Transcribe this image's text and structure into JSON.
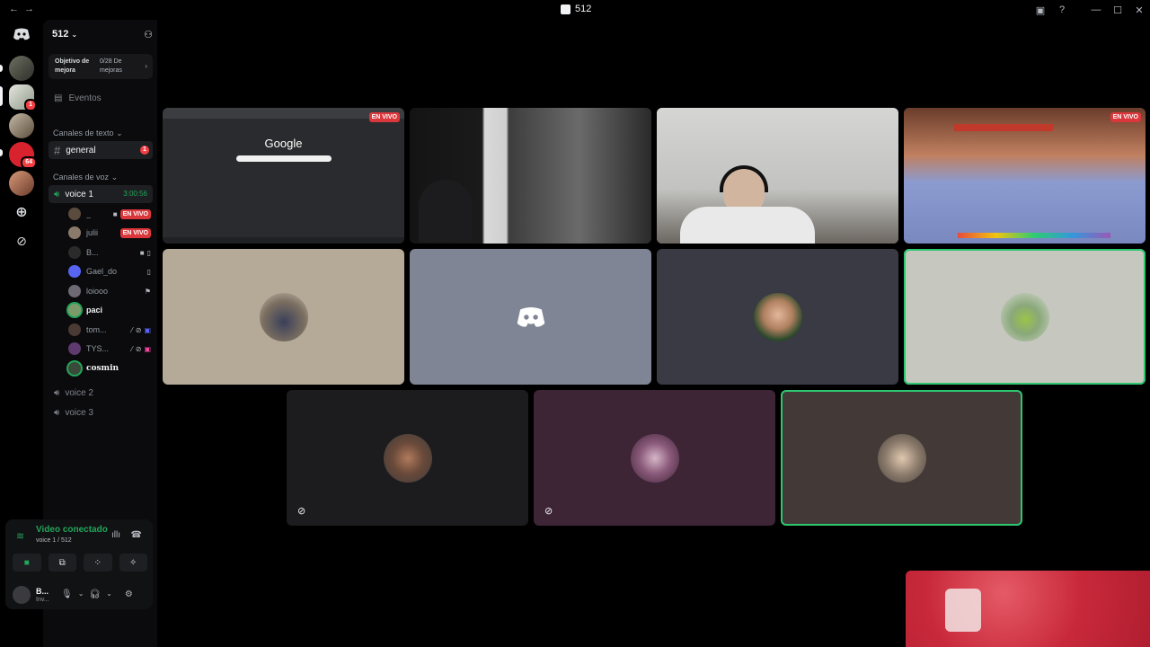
{
  "window": {
    "title": "512",
    "nav_back": "←",
    "nav_forward": "→"
  },
  "server": {
    "name": "512",
    "boost_goal": "Objetivo de mejora",
    "boost_count": "0/28 De mejoras",
    "events_label": "Eventos"
  },
  "rail": {
    "badge_1": "1",
    "badge_64": "64"
  },
  "channels": {
    "text_category": "Canales de texto",
    "general": "general",
    "general_badge": "1",
    "voice_category": "Canales de voz",
    "voice1": "voice 1",
    "voice1_timer": "3:00:56",
    "voice2": "voice 2",
    "voice3": "voice 3"
  },
  "voice_users": [
    {
      "name": "_",
      "live": "EN VIVO"
    },
    {
      "name": "julii",
      "live": "EN VIVO"
    },
    {
      "name": "B..."
    },
    {
      "name": "Gael_do"
    },
    {
      "name": "loiooo"
    },
    {
      "name": "paci"
    },
    {
      "name": "tom..."
    },
    {
      "name": "TYS..."
    },
    {
      "name": "cosmin"
    }
  ],
  "voice_panel": {
    "status": "Video conectado",
    "sub": "voice 1 / 512"
  },
  "user": {
    "name": "B...",
    "status": "Inv..."
  },
  "tiles": {
    "live_label": "EN VIVO",
    "google_logo": "Google"
  },
  "colors": {
    "speaking": "#2dc770",
    "live": "#da373c",
    "connected": "#23a55a"
  }
}
